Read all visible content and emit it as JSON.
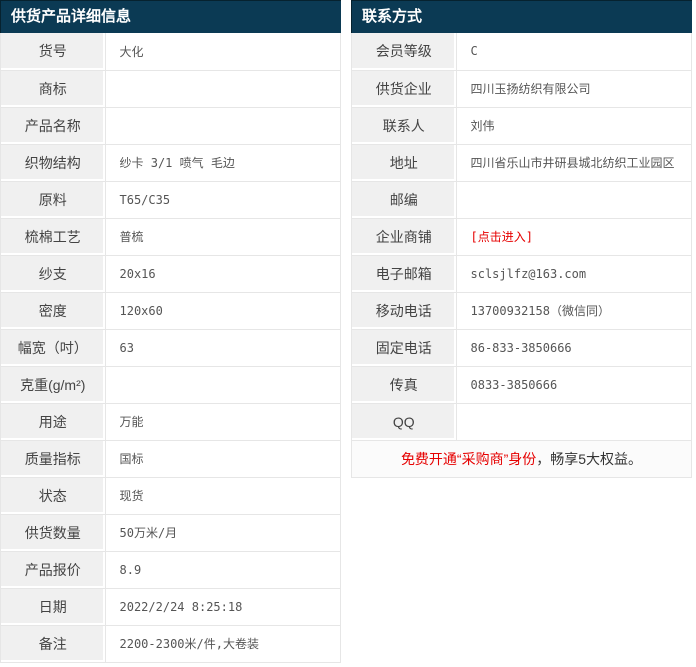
{
  "colors": {
    "header_bg": "#0b3a54",
    "header_text": "#ffffff",
    "label_bg": "#f0f0f0",
    "border": "#e6e6e6",
    "label_text": "#444444",
    "value_text": "#555555",
    "red": "#e60000",
    "footer_text": "#333333"
  },
  "product_panel": {
    "title": "供货产品详细信息",
    "rows": [
      {
        "label": "货号",
        "value": "大化"
      },
      {
        "label": "商标",
        "value": ""
      },
      {
        "label": "产品名称",
        "value": ""
      },
      {
        "label": "织物结构",
        "value": "纱卡 3/1 喷气 毛边"
      },
      {
        "label": "原料",
        "value": "T65/C35"
      },
      {
        "label": "梳棉工艺",
        "value": "普梳"
      },
      {
        "label": "纱支",
        "value": "20x16"
      },
      {
        "label": "密度",
        "value": "120x60"
      },
      {
        "label": "幅宽（吋）",
        "value": "63"
      },
      {
        "label": "克重(g/m²)",
        "value": ""
      },
      {
        "label": "用途",
        "value": "万能"
      },
      {
        "label": "质量指标",
        "value": "国标"
      },
      {
        "label": "状态",
        "value": "现货"
      },
      {
        "label": "供货数量",
        "value": "50万米/月"
      },
      {
        "label": "产品报价",
        "value": "8.9"
      },
      {
        "label": "日期",
        "value": "2022/2/24 8:25:18"
      },
      {
        "label": "备注",
        "value": "2200-2300米/件,大卷装"
      }
    ]
  },
  "contact_panel": {
    "title": "联系方式",
    "rows": [
      {
        "label": "会员等级",
        "value": "C"
      },
      {
        "label": "供货企业",
        "value": "四川玉扬纺织有限公司"
      },
      {
        "label": "联系人",
        "value": "刘伟"
      },
      {
        "label": "地址",
        "value": "四川省乐山市井研县城北纺织工业园区"
      },
      {
        "label": "邮编",
        "value": ""
      },
      {
        "label": "企业商铺",
        "value": "[点击进入]"
      },
      {
        "label": "电子邮箱",
        "value": "sclsjlfz@163.com"
      },
      {
        "label": "移动电话",
        "value": "13700932158（微信同）"
      },
      {
        "label": "固定电话",
        "value": "86-833-3850666"
      },
      {
        "label": "传真",
        "value": "0833-3850666"
      },
      {
        "label": "QQ",
        "value": ""
      }
    ],
    "footer": {
      "highlight": "免费开通“采购商”身份",
      "rest": "，畅享5大权益。"
    }
  }
}
